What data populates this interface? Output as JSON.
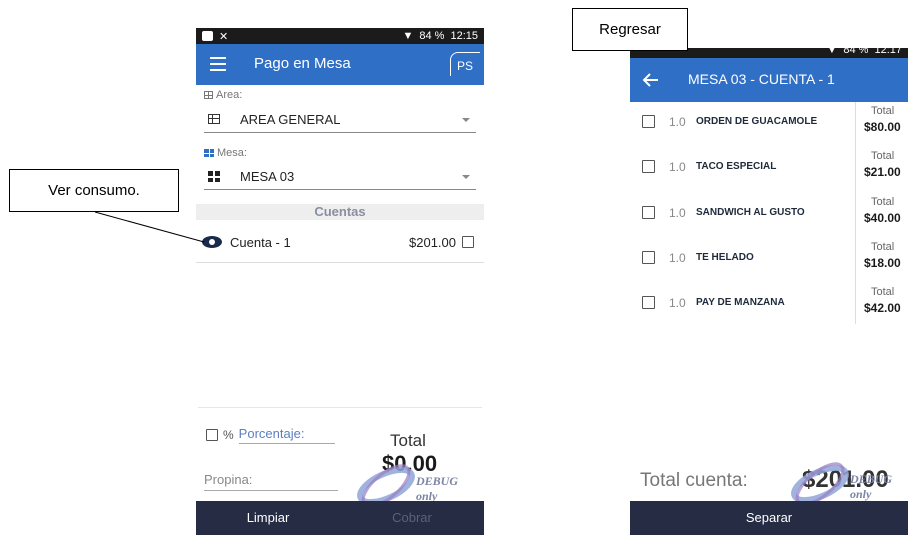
{
  "screen_pago_mesa": {
    "status": {
      "signal": "▼",
      "battery": "84 %",
      "time": "12:15"
    },
    "app_title": "Pago en Mesa",
    "logo_text": "PS",
    "area": {
      "label": "Area:",
      "value": "AREA GENERAL"
    },
    "mesa": {
      "label": "Mesa:",
      "value": "MESA 03"
    },
    "cuentas_header": "Cuentas",
    "cuentas": [
      {
        "name": "Cuenta - 1",
        "amount": "$201.00"
      }
    ],
    "percent_symbol": "%",
    "porcentaje_label": "Porcentaje:",
    "propina_placeholder": "Propina:",
    "total_label": "Total",
    "total_value": "$0.00",
    "watermark": "DEBUG only",
    "buttons": {
      "limpiar": "Limpiar",
      "cobrar": "Cobrar"
    }
  },
  "screen_cuenta_detalle": {
    "status": {
      "signal": "▼",
      "battery": "84 %",
      "time": "12:17"
    },
    "app_title": "MESA 03 - CUENTA - 1",
    "items": [
      {
        "qty": "1.0",
        "name": "ORDEN DE GUACAMOLE",
        "total_label": "Total",
        "price": "$80.00"
      },
      {
        "qty": "1.0",
        "name": "TACO ESPECIAL",
        "total_label": "Total",
        "price": "$21.00"
      },
      {
        "qty": "1.0",
        "name": "SANDWICH AL GUSTO",
        "total_label": "Total",
        "price": "$40.00"
      },
      {
        "qty": "1.0",
        "name": "TE HELADO",
        "total_label": "Total",
        "price": "$18.00"
      },
      {
        "qty": "1.0",
        "name": "PAY DE MANZANA",
        "total_label": "Total",
        "price": "$42.00"
      }
    ],
    "total_cuenta_label": "Total cuenta:",
    "total_cuenta_value": "$201.00",
    "watermark": "DEBUG only",
    "buttons": {
      "separar": "Separar"
    }
  },
  "callouts": {
    "ver_consumo": "Ver consumo.",
    "regresar": "Regresar"
  },
  "colors": {
    "app_bar": "#2f6fc6",
    "bottom_bar": "#252c43",
    "status_bar": "#1b1b1b"
  }
}
